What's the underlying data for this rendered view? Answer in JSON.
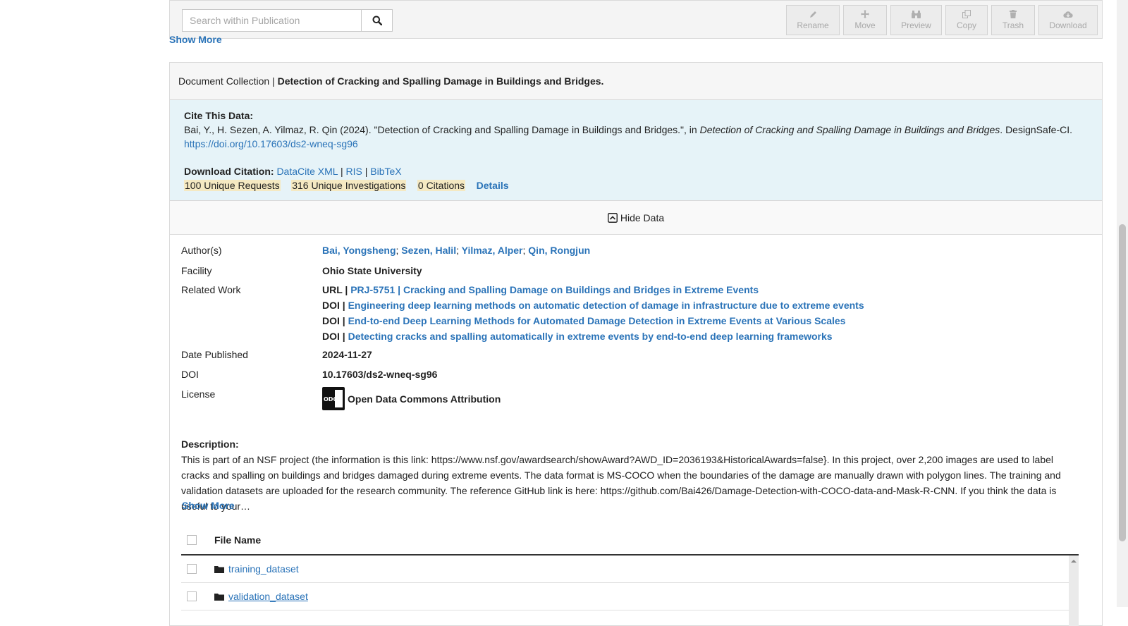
{
  "toolbar": {
    "search_placeholder": "Search within Publication",
    "buttons": [
      {
        "label": "Rename",
        "icon": "pencil-icon"
      },
      {
        "label": "Move",
        "icon": "move-icon"
      },
      {
        "label": "Preview",
        "icon": "binoculars-icon"
      },
      {
        "label": "Copy",
        "icon": "copy-icon"
      },
      {
        "label": "Trash",
        "icon": "trash-icon"
      },
      {
        "label": "Download",
        "icon": "cloud-download-icon"
      }
    ]
  },
  "top_show_more": "Show More",
  "collection": {
    "type_label": "Document Collection |",
    "title": "Detection of Cracking and Spalling Damage in Buildings and Bridges.",
    "cite_heading": "Cite This Data:",
    "citation_prefix": "Bai, Y., H. Sezen, A. Yilmaz, R. Qin (2024). \"Detection of Cracking and Spalling Damage in Buildings and Bridges.\", in ",
    "citation_italic": "Detection of Cracking and Spalling Damage in Buildings and Bridges",
    "citation_suffix": ". DesignSafe-CI.",
    "doi_link": "https://doi.org/10.17603/ds2-wneq-sg96",
    "download_label": "Download Citation:",
    "download_formats": [
      "DataCite XML",
      "RIS",
      "BibTeX"
    ],
    "metrics": [
      "100 Unique Requests",
      "316 Unique Investigations",
      "0 Citations"
    ],
    "details_label": "Details",
    "hide_data_label": "Hide Data"
  },
  "meta": {
    "authors_label": "Author(s)",
    "authors": [
      "Bai, Yongsheng",
      "Sezen, Halil",
      "Yilmaz, Alper",
      "Qin, Rongjun"
    ],
    "facility_label": "Facility",
    "facility": "Ohio State University",
    "related_label": "Related Work",
    "related": [
      {
        "type": "URL |",
        "title": "PRJ-5751 | Cracking and Spalling Damage on Buildings and Bridges in Extreme Events"
      },
      {
        "type": "DOI |",
        "title": "Engineering deep learning methods on automatic detection of damage in infrastructure due to extreme events"
      },
      {
        "type": "DOI |",
        "title": "End-to-end Deep Learning Methods for Automated Damage Detection in Extreme Events at Various Scales"
      },
      {
        "type": "DOI |",
        "title": "Detecting cracks and spalling automatically in extreme events by end-to-end deep learning frameworks"
      }
    ],
    "date_label": "Date Published",
    "date": "2024-11-27",
    "doi_label": "DOI",
    "doi": "10.17603/ds2-wneq-sg96",
    "license_label": "License",
    "license": "Open Data Commons Attribution",
    "license_icon_text": "ODC"
  },
  "description": {
    "label": "Description:",
    "text": "This is part of an NSF project (the information is this link: https://www.nsf.gov/awardsearch/showAward?AWD_ID=2036193&HistoricalAwards=false}. In this project, over 2,200 images are used to label cracks and spalling on buildings and bridges damaged during extreme events. The data format is MS-COCO when the boundaries of the damage are manually drawn with polygon lines. The training and validation datasets are uploaded for the research community. The reference GitHub link is here: https://github.com/Bai426/Damage-Detection-with-COCO-data-and-Mask-R-CNN. If you think the data is useful to your…",
    "show_more": "Show More"
  },
  "files": {
    "header": "File Name",
    "rows": [
      "training_dataset",
      "validation_dataset"
    ]
  }
}
